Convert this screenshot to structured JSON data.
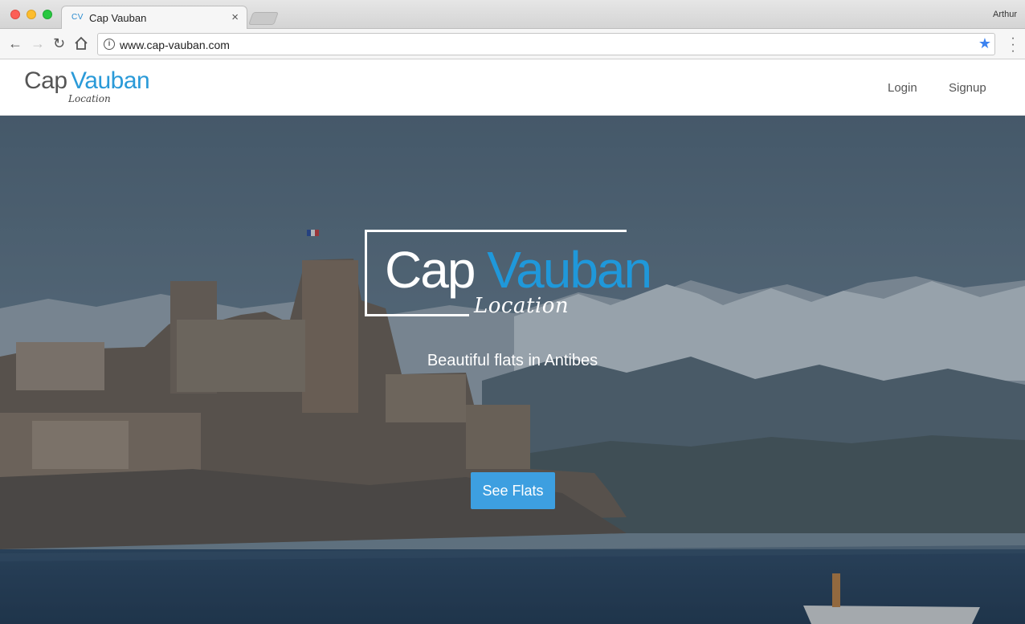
{
  "browser": {
    "tab": {
      "favicon_text": "CV",
      "title": "Cap Vauban",
      "close_glyph": "×"
    },
    "profile_name": "Arthur",
    "url": "www.cap-vauban.com",
    "icons": {
      "back": "back-arrow-icon",
      "forward": "forward-arrow-icon",
      "reload": "reload-icon",
      "home": "home-icon",
      "info": "info-icon",
      "bookmark": "star-icon",
      "menu": "menu-dots-icon"
    },
    "accent_color": "#3b82f0"
  },
  "header": {
    "logo": {
      "cap": "Cap",
      "vauban": "Vauban",
      "sub": "Location"
    },
    "nav": {
      "login": "Login",
      "signup": "Signup"
    }
  },
  "hero": {
    "logo": {
      "cap": "Cap",
      "vauban": "Vauban",
      "sub": "Location"
    },
    "tagline": "Beautiful flats in Antibes",
    "cta_label": "See Flats"
  },
  "colors": {
    "brand_blue": "#2a9ad8",
    "button_blue": "#3d9fe0"
  }
}
